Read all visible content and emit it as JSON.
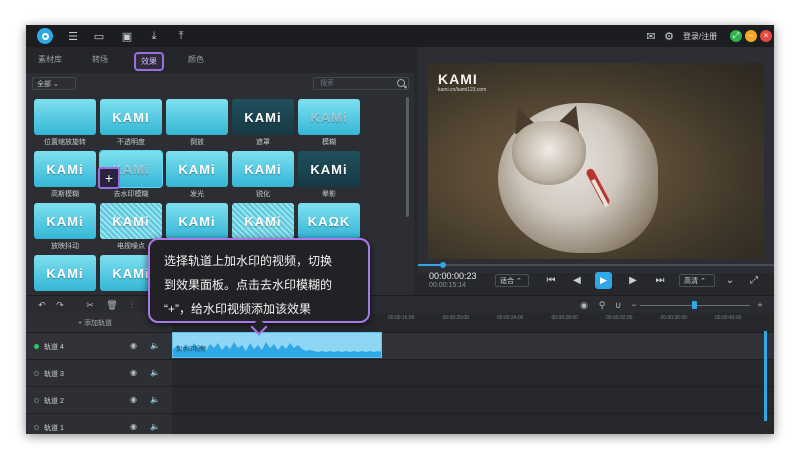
{
  "header": {
    "login_label": "登录/注册"
  },
  "tabs": [
    "素材库",
    "转场",
    "效果",
    "颜色"
  ],
  "filter": {
    "value": "全部"
  },
  "search": {
    "placeholder": "搜索"
  },
  "effects": [
    {
      "thumb": "",
      "label": "位置缩放旋转"
    },
    {
      "thumb": "KAMI",
      "label": "不透明度"
    },
    {
      "thumb": "",
      "label": "倒放"
    },
    {
      "thumb": "KAMi",
      "label": "遮罩"
    },
    {
      "thumb": "KAMi",
      "label": "模糊"
    },
    {
      "thumb": "KAMi",
      "label": "高斯模糊"
    },
    {
      "thumb": "KAMi",
      "label": "去水印模糊"
    },
    {
      "thumb": "KAMi",
      "label": "发光"
    },
    {
      "thumb": "KAMi",
      "label": "锐化"
    },
    {
      "thumb": "KAMi",
      "label": "晕影"
    },
    {
      "thumb": "KAMi",
      "label": "放映抖动"
    },
    {
      "thumb": "KAMi",
      "label": "电视噪点"
    },
    {
      "thumb": "KAMi",
      "label": ""
    },
    {
      "thumb": "KAMi",
      "label": ""
    },
    {
      "thumb": "KAΩK",
      "label": ""
    },
    {
      "thumb": "KAMi",
      "label": ""
    },
    {
      "thumb": "KAMi",
      "label": ""
    }
  ],
  "preview": {
    "watermark": "KAMI",
    "watermark_sub": "kami.cn/kami123.com",
    "timecode_current": "00:00:00:23",
    "timecode_total": "00:00:15:14",
    "fit_label": "适合",
    "quality_label": "高清",
    "progress": 0.07
  },
  "timeline": {
    "add_track_label": "+ 添加轨道",
    "ruler": [
      "00:00:16:00",
      "00:00:20:00",
      "00:00:24:00",
      "00:00:28:00",
      "00:00:32:00",
      "00:00:36:00",
      "00:00:40:00"
    ],
    "tracks": [
      {
        "name": "轨道 4",
        "active": true
      },
      {
        "name": "轨道 3",
        "active": false
      },
      {
        "name": "轨道 2",
        "active": false
      },
      {
        "name": "轨道 1",
        "active": false
      }
    ],
    "clip_label": "加水印视频"
  },
  "tooltip": {
    "lines": [
      "选择轨道上加水印的视频，切换",
      "到效果面板。点击去水印模糊的",
      "“+”，给水印视频添加该效果"
    ]
  },
  "colors": {
    "accent": "#2fa8e6",
    "highlight": "#a77ae8"
  }
}
